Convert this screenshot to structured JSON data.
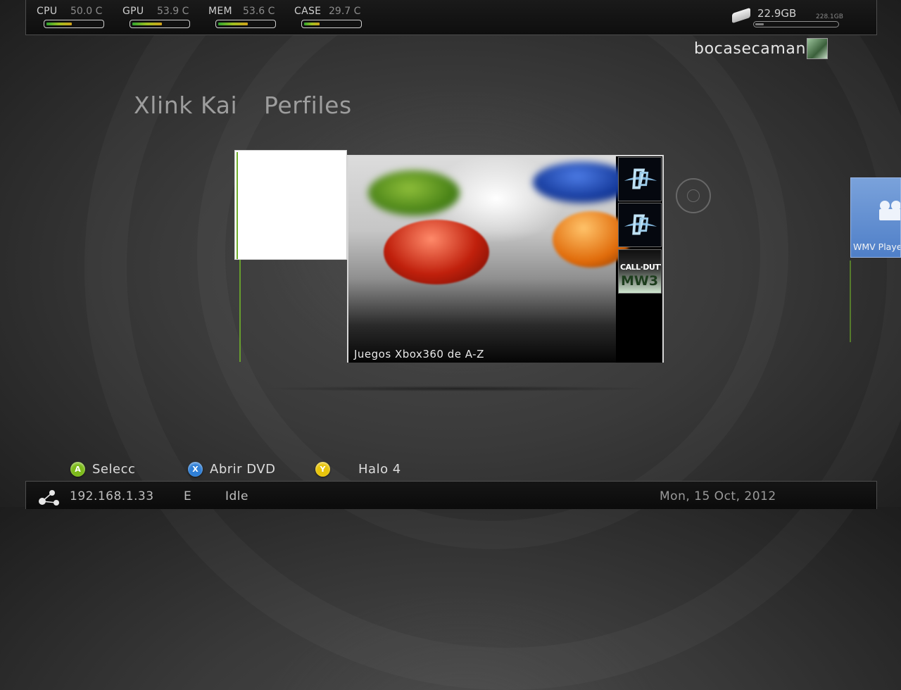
{
  "stats": [
    {
      "label": "CPU",
      "value": "50.0 C",
      "level": 0.45
    },
    {
      "label": "GPU",
      "value": "53.9 C",
      "level": 0.52
    },
    {
      "label": "MEM",
      "value": "53.6 C",
      "level": 0.52
    },
    {
      "label": "CASE",
      "value": "29.7 C",
      "level": 0.27
    }
  ],
  "disk": {
    "free": "22.9GB",
    "total": "228.1GB",
    "level": 0.1
  },
  "profile": {
    "username": "bocasecaman"
  },
  "nav": {
    "item1": "Xlink Kai",
    "item2": "Perfiles"
  },
  "main_tile": {
    "caption": "Juegos Xbox360 de A-Z",
    "thumbnails": [
      {
        "icon": "halo-4-icon"
      },
      {
        "icon": "halo-4-icon"
      },
      {
        "title": "CALL·DUTY",
        "subtitle": "MW3"
      }
    ]
  },
  "side_tile": {
    "label": "WMV Player",
    "icon": "camera-icon"
  },
  "hints": [
    {
      "button": "A",
      "label": "Selecc",
      "color": "#7dbb1b"
    },
    {
      "button": "X",
      "label": "Abrir DVD",
      "color": "#2f7fd6"
    },
    {
      "button": "Y",
      "label": "Halo 4",
      "color": "#e8c50c"
    }
  ],
  "status": {
    "ip": "192.168.1.33",
    "drive": "E",
    "state": "Idle",
    "date": "Mon, 15 Oct, 2012"
  }
}
